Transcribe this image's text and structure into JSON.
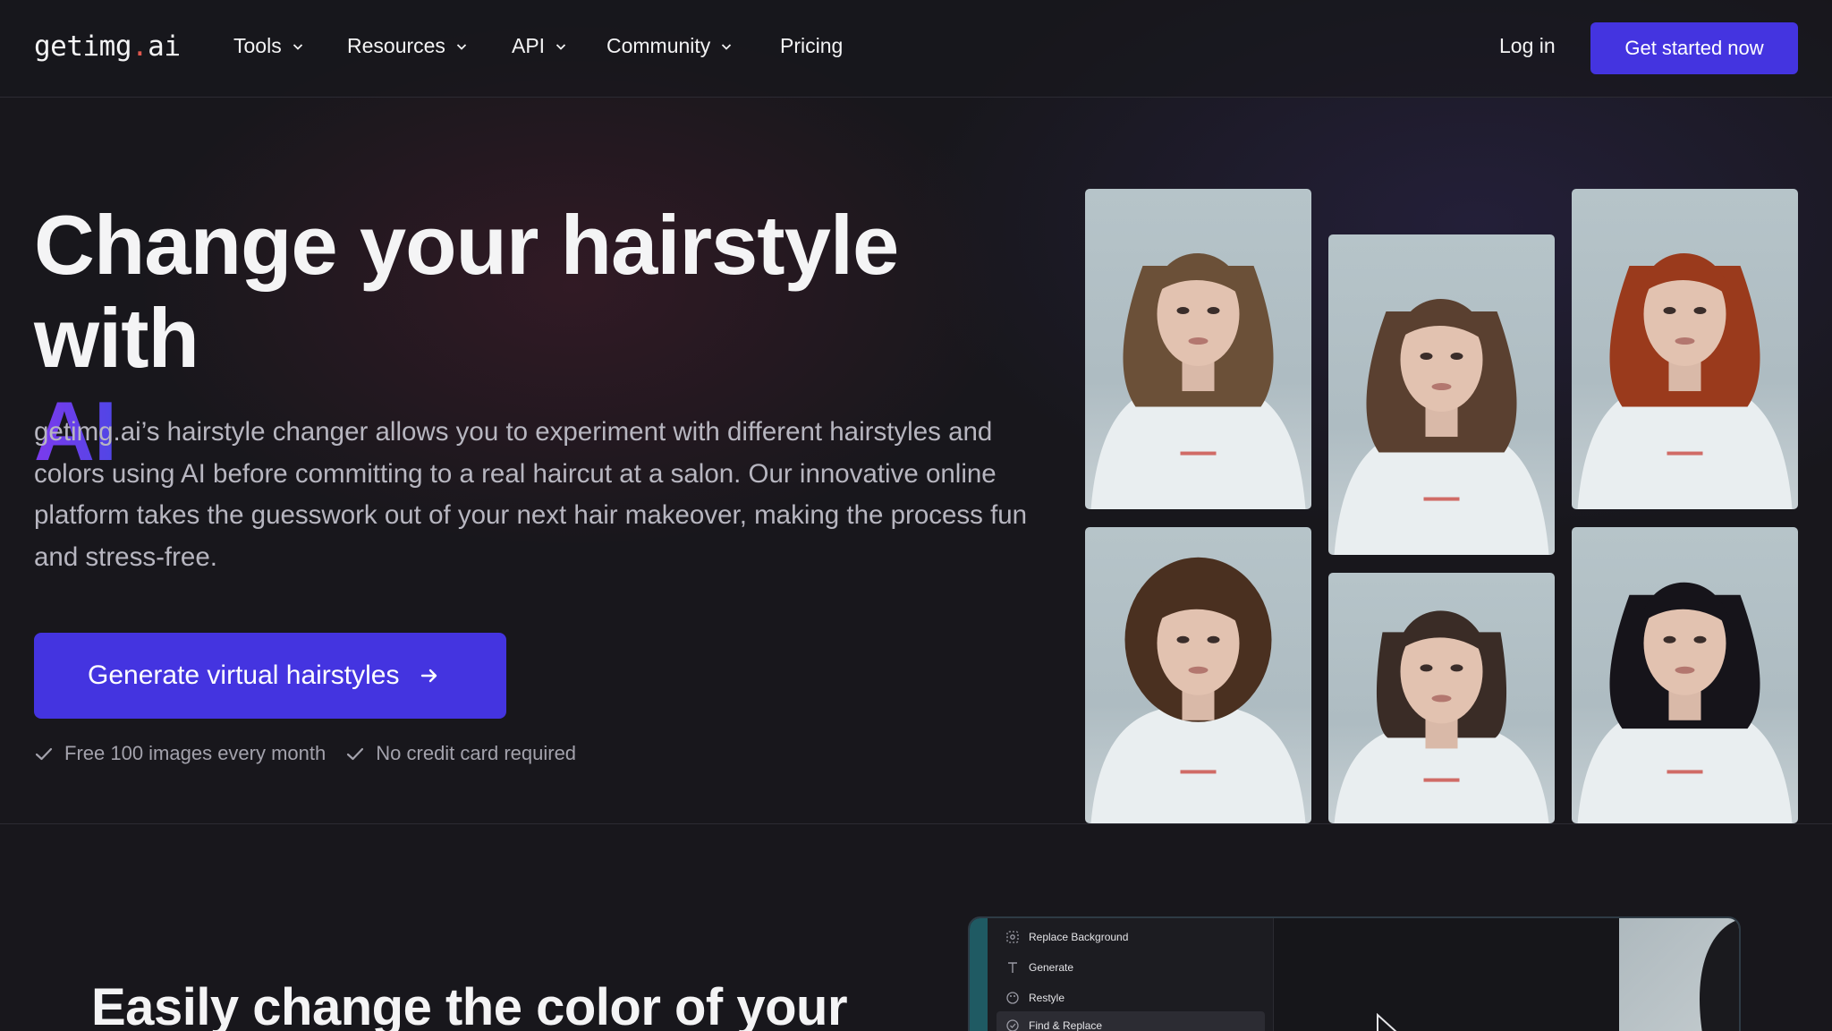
{
  "nav": {
    "logo_pre": "getimg",
    "logo_dot": ".",
    "logo_post": "ai",
    "items": [
      {
        "label": "Tools"
      },
      {
        "label": "Resources"
      },
      {
        "label": "API"
      },
      {
        "label": "Community"
      },
      {
        "label": "Pricing"
      }
    ],
    "login": "Log in",
    "cta": "Get started now"
  },
  "hero": {
    "title": "Change your hairstyle with",
    "title_accent": "AI",
    "description": "getimg.ai’s hairstyle changer allows you to experiment with different hairstyles and colors using AI before committing to a real haircut at a salon. Our innovative online platform takes the guesswork out of your next hair makeover, making the process fun and stress-free.",
    "cta": "Generate virtual hairstyles",
    "perks": [
      "Free 100 images every month",
      "No credit card required"
    ]
  },
  "gallery": {
    "tiles": [
      {
        "hair": "#6b5038",
        "style": "long-wavy"
      },
      {
        "hair": "#5a4030",
        "style": "side-swept-ombre"
      },
      {
        "hair": "#9a3a1c",
        "style": "red-curls"
      },
      {
        "hair": "#4a3020",
        "style": "short-curly"
      },
      {
        "hair": "#3a2c26",
        "style": "bob"
      },
      {
        "hair": "#16141a",
        "style": "black-long"
      }
    ]
  },
  "section2": {
    "title": "Easily change the color of your"
  },
  "app_preview": {
    "menu": [
      "Replace Background",
      "Generate",
      "Restyle",
      "Find & Replace"
    ]
  },
  "colors": {
    "accent": "#4434e0",
    "accent_gradient_start": "#7c3aed",
    "background": "#18171c"
  }
}
